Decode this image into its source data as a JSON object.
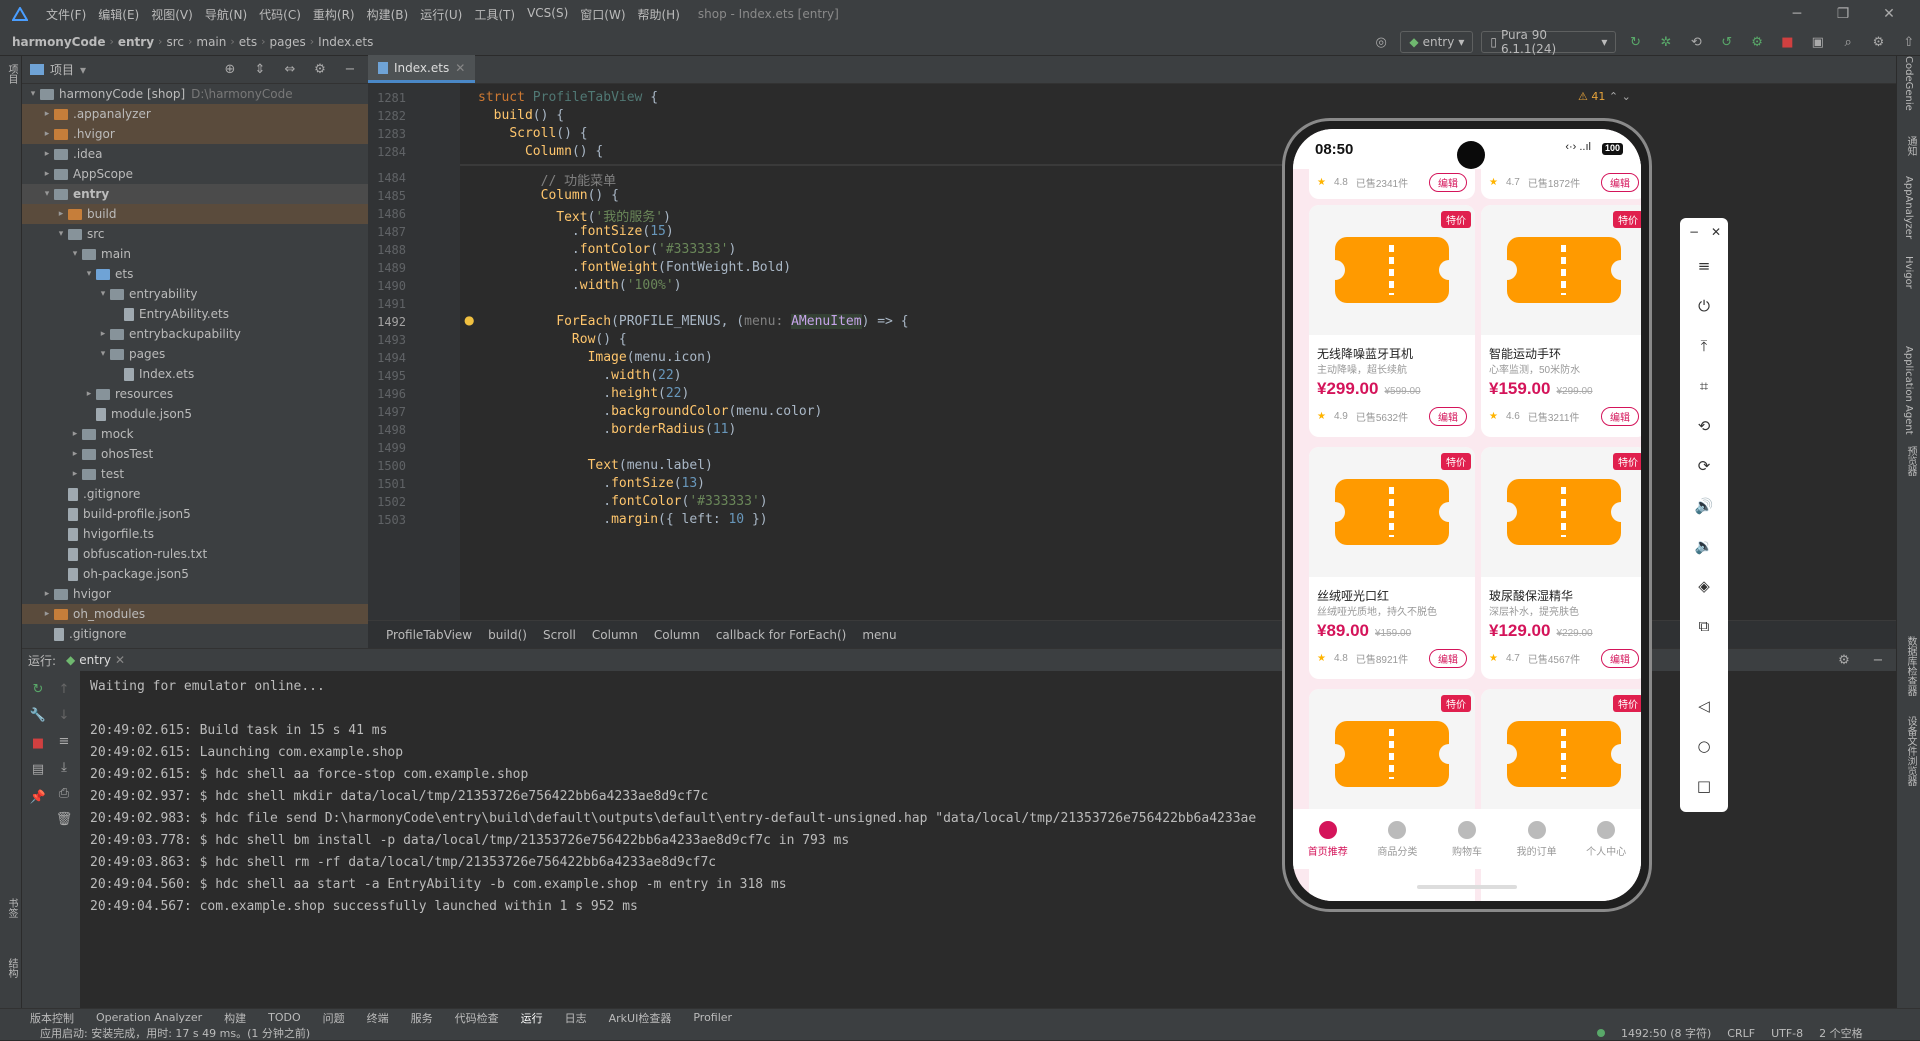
{
  "menubar": {
    "items": [
      "文件(F)",
      "编辑(E)",
      "视图(V)",
      "导航(N)",
      "代码(C)",
      "重构(R)",
      "构建(B)",
      "运行(U)",
      "工具(T)",
      "VCS(S)",
      "窗口(W)",
      "帮助(H)"
    ],
    "title": "shop - Index.ets [entry]"
  },
  "navbar": {
    "crumbs": [
      "harmonyCode",
      "entry",
      "src",
      "main",
      "ets",
      "pages",
      "Index.ets"
    ],
    "run_config": "entry",
    "device": "Pura 90 6.1.1(24)"
  },
  "project": {
    "title": "项目",
    "tree": [
      {
        "label": "harmonyCode [shop]",
        "path": "D:\\harmonyCode",
        "depth": 0,
        "open": true,
        "icon": "folder"
      },
      {
        "label": ".appanalyzer",
        "depth": 1,
        "open": false,
        "icon": "ofolder",
        "excluded": true
      },
      {
        "label": ".hvigor",
        "depth": 1,
        "open": false,
        "icon": "ofolder",
        "excluded": true
      },
      {
        "label": ".idea",
        "depth": 1,
        "open": false,
        "icon": "folder"
      },
      {
        "label": "AppScope",
        "depth": 1,
        "open": false,
        "icon": "folder"
      },
      {
        "label": "entry",
        "depth": 1,
        "open": true,
        "icon": "folder",
        "bold": true,
        "selected": true
      },
      {
        "label": "build",
        "depth": 2,
        "open": false,
        "icon": "ofolder",
        "excluded": true
      },
      {
        "label": "src",
        "depth": 2,
        "open": true,
        "icon": "folder"
      },
      {
        "label": "main",
        "depth": 3,
        "open": true,
        "icon": "folder"
      },
      {
        "label": "ets",
        "depth": 4,
        "open": true,
        "icon": "bfolder"
      },
      {
        "label": "entryability",
        "depth": 5,
        "open": true,
        "icon": "folder"
      },
      {
        "label": "EntryAbility.ets",
        "depth": 6,
        "icon": "file"
      },
      {
        "label": "entrybackupability",
        "depth": 5,
        "open": false,
        "icon": "folder"
      },
      {
        "label": "pages",
        "depth": 5,
        "open": true,
        "icon": "folder"
      },
      {
        "label": "Index.ets",
        "depth": 6,
        "icon": "file"
      },
      {
        "label": "resources",
        "depth": 4,
        "open": false,
        "icon": "folder"
      },
      {
        "label": "module.json5",
        "depth": 4,
        "icon": "file"
      },
      {
        "label": "mock",
        "depth": 3,
        "open": false,
        "icon": "folder"
      },
      {
        "label": "ohosTest",
        "depth": 3,
        "open": false,
        "icon": "folder"
      },
      {
        "label": "test",
        "depth": 3,
        "open": false,
        "icon": "folder"
      },
      {
        "label": ".gitignore",
        "depth": 2,
        "icon": "file"
      },
      {
        "label": "build-profile.json5",
        "depth": 2,
        "icon": "file"
      },
      {
        "label": "hvigorfile.ts",
        "depth": 2,
        "icon": "file"
      },
      {
        "label": "obfuscation-rules.txt",
        "depth": 2,
        "icon": "file"
      },
      {
        "label": "oh-package.json5",
        "depth": 2,
        "icon": "file"
      },
      {
        "label": "hvigor",
        "depth": 1,
        "open": false,
        "icon": "folder"
      },
      {
        "label": "oh_modules",
        "depth": 1,
        "open": false,
        "icon": "ofolder",
        "excluded": true
      },
      {
        "label": ".gitignore",
        "depth": 1,
        "icon": "file"
      }
    ]
  },
  "editor": {
    "tab": "Index.ets",
    "warnings": "41",
    "breadcrumbs": [
      "ProfileTabView",
      "build()",
      "Scroll",
      "Column",
      "Column",
      "callback for ForEach()",
      "menu"
    ]
  },
  "run": {
    "label": "运行:",
    "tab": "entry",
    "log": [
      "Waiting for emulator online...",
      "",
      "20:49:02.615: Build task in 15 s 41 ms",
      "20:49:02.615: Launching com.example.shop",
      "20:49:02.615: $ hdc shell aa force-stop com.example.shop",
      "20:49:02.937: $ hdc shell mkdir data/local/tmp/21353726e756422bb6a4233ae8d9cf7c",
      "20:49:02.983: $ hdc file send D:\\harmonyCode\\entry\\build\\default\\outputs\\default\\entry-default-unsigned.hap \"data/local/tmp/21353726e756422bb6a4233ae",
      "20:49:03.778: $ hdc shell bm install -p data/local/tmp/21353726e756422bb6a4233ae8d9cf7c in 793 ms",
      "20:49:03.863: $ hdc shell rm -rf data/local/tmp/21353726e756422bb6a4233ae8d9cf7c",
      "20:49:04.560: $ hdc shell aa start -a EntryAbility -b com.example.shop -m entry in 318 ms",
      "20:49:04.567: com.example.shop successfully launched within 1 s 952 ms"
    ]
  },
  "toolwindows": [
    "版本控制",
    "Operation Analyzer",
    "构建",
    "TODO",
    "问题",
    "终端",
    "服务",
    "代码检查",
    "运行",
    "日志",
    "ArkUI检查器",
    "Profiler"
  ],
  "status": {
    "left": "应用启动: 安装完成，用时: 17 s 49 ms。(1 分钟之前)",
    "position": "1492:50 (8 字符)",
    "line_sep": "CRLF",
    "encoding": "UTF-8",
    "indent": "2 个空格"
  },
  "right_tools": [
    "CodeGenie",
    "通知",
    "AppAnalyzer",
    "Hvigor",
    "Application Agent",
    "预览器",
    "数据库检查器",
    "设备文件浏览器"
  ],
  "left_tools": [
    "项目",
    "书签",
    "结构"
  ],
  "phone": {
    "time": "08:50",
    "battery": "100",
    "top_row": [
      {
        "rating": "4.8",
        "sold": "已售2341件",
        "edit": "编辑"
      },
      {
        "rating": "4.7",
        "sold": "已售1872件",
        "edit": "编辑"
      }
    ],
    "products": [
      {
        "badge": "特价",
        "name": "无线降噪蓝牙耳机",
        "desc": "主动降噪，超长续航",
        "price": "¥299.00",
        "old": "¥599.00",
        "rating": "4.9",
        "sold": "已售5632件",
        "edit": "编辑"
      },
      {
        "badge": "特价",
        "name": "智能运动手环",
        "desc": "心率监测，50米防水",
        "price": "¥159.00",
        "old": "¥299.00",
        "rating": "4.6",
        "sold": "已售3211件",
        "edit": "编辑"
      },
      {
        "badge": "特价",
        "name": "丝绒哑光口红",
        "desc": "丝绒哑光质地，持久不脱色",
        "price": "¥89.00",
        "old": "¥159.00",
        "rating": "4.8",
        "sold": "已售8921件",
        "edit": "编辑"
      },
      {
        "badge": "特价",
        "name": "玻尿酸保湿精华",
        "desc": "深层补水，提亮肤色",
        "price": "¥129.00",
        "old": "¥229.00",
        "rating": "4.7",
        "sold": "已售4567件",
        "edit": "编辑"
      },
      {
        "badge": "特价"
      },
      {
        "badge": "特价"
      }
    ],
    "nav": [
      {
        "label": "首页推荐",
        "active": true
      },
      {
        "label": "商品分类"
      },
      {
        "label": "购物车"
      },
      {
        "label": "我的订单"
      },
      {
        "label": "个人中心"
      }
    ]
  }
}
